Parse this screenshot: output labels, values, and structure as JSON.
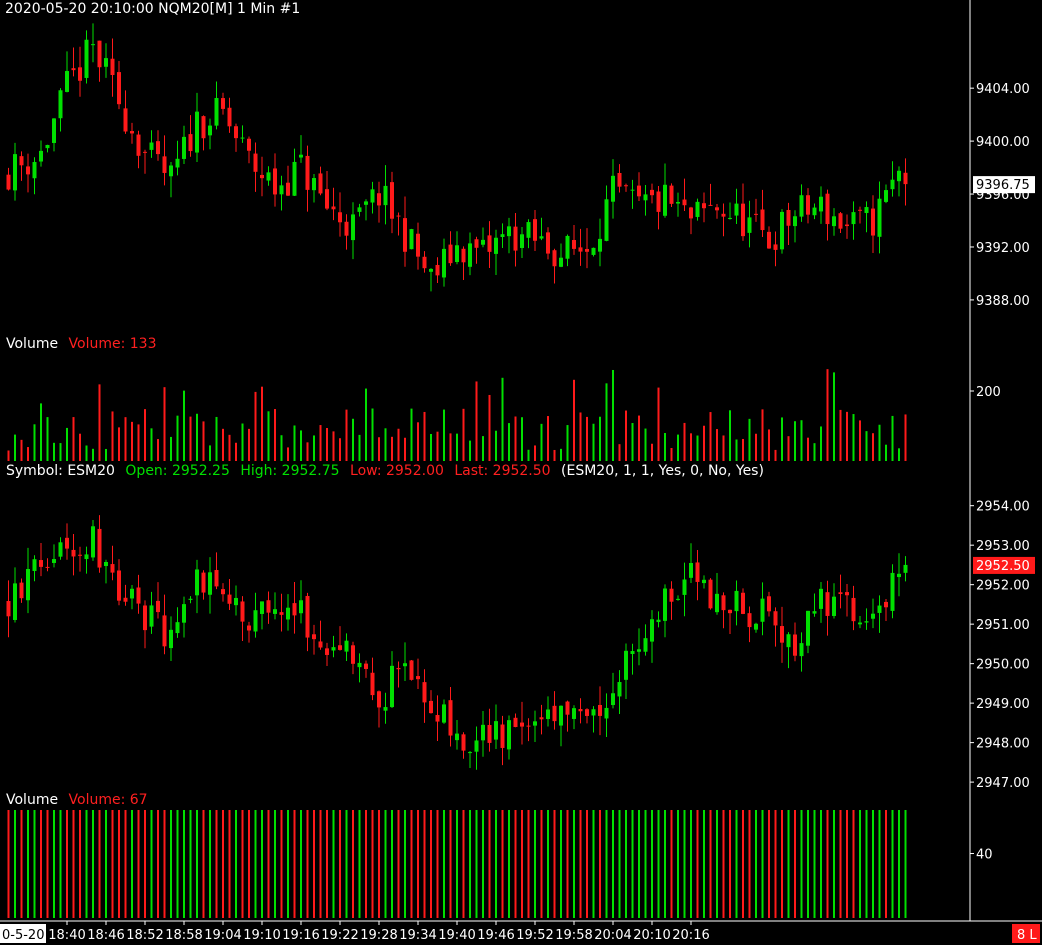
{
  "colors": {
    "background": "#000000",
    "up": "#00e000",
    "down": "#ff1a1a",
    "axis": "#ffffff",
    "text": "#ffffff"
  },
  "top_header": "2020-05-20 20:10:00 NQM20[M]  1 Min   #1",
  "panel2_header": {
    "label": "Volume",
    "value_text": "Volume: 133"
  },
  "panel3_header": {
    "symbol": "Symbol: ESM20",
    "open": "Open: 2952.25",
    "high": "High: 2952.75",
    "low": "Low: 2952.00",
    "last": "Last: 2952.50",
    "params": "(ESM20, 1, 1, Yes, 0, No, Yes)"
  },
  "panel4_header": {
    "label": "Volume",
    "value_text": "Volume: 67"
  },
  "date_corner": "0-5-20",
  "corner_badge": "8 L",
  "chart_data": [
    {
      "type": "candlestick",
      "name": "NQM20",
      "yticks": [
        9388,
        9392,
        9396,
        9400,
        9404
      ],
      "tick_labels": [
        "9388.00",
        "9392.00",
        "9396.00",
        "9400.00",
        "9404.00"
      ],
      "ylim": [
        9385.5,
        9409.0
      ],
      "last_badge": "9396.75",
      "last_value": 9396.75,
      "seed": 11,
      "keypoints": [
        [
          0,
          9397.5
        ],
        [
          6,
          9399
        ],
        [
          10,
          9404
        ],
        [
          14,
          9407
        ],
        [
          18,
          9403
        ],
        [
          22,
          9399
        ],
        [
          26,
          9397
        ],
        [
          30,
          9401.5
        ],
        [
          34,
          9402
        ],
        [
          38,
          9398.5
        ],
        [
          42,
          9396.5
        ],
        [
          46,
          9398
        ],
        [
          50,
          9395
        ],
        [
          54,
          9393.5
        ],
        [
          58,
          9396
        ],
        [
          62,
          9393
        ],
        [
          66,
          9389.5
        ],
        [
          70,
          9392
        ],
        [
          74,
          9391.5
        ],
        [
          78,
          9393
        ],
        [
          82,
          9392.5
        ],
        [
          86,
          9391.5
        ],
        [
          90,
          9392
        ],
        [
          94,
          9396
        ],
        [
          98,
          9395
        ],
        [
          102,
          9395.5
        ],
        [
          106,
          9394
        ],
        [
          110,
          9395
        ],
        [
          114,
          9394
        ],
        [
          118,
          9392.5
        ],
        [
          122,
          9394.5
        ],
        [
          126,
          9395
        ],
        [
          130,
          9393.5
        ],
        [
          134,
          9394
        ],
        [
          138,
          9397.5
        ]
      ]
    },
    {
      "type": "bar",
      "name": "Volume NQM20",
      "yticks": [
        200
      ],
      "tick_labels": [
        "200"
      ],
      "ylim": [
        0,
        300
      ],
      "seed": 23
    },
    {
      "type": "candlestick",
      "name": "ESM20",
      "yticks": [
        2947,
        2948,
        2949,
        2950,
        2951,
        2952,
        2953,
        2954
      ],
      "tick_labels": [
        "2947.00",
        "2948.00",
        "2949.00",
        "2950.00",
        "2951.00",
        "2952.00",
        "2953.00",
        "2954.00"
      ],
      "ylim": [
        2946.8,
        2954.6
      ],
      "last_badge": "2952.50",
      "last_value": 2952.5,
      "open": 2952.25,
      "high": 2952.75,
      "low": 2952.0,
      "last": 2952.5,
      "seed": 37,
      "keypoints": [
        [
          0,
          2951.5
        ],
        [
          6,
          2952.5
        ],
        [
          10,
          2953.0
        ],
        [
          14,
          2953.2
        ],
        [
          18,
          2952.0
        ],
        [
          22,
          2951.2
        ],
        [
          26,
          2950.5
        ],
        [
          30,
          2952.0
        ],
        [
          34,
          2951.7
        ],
        [
          38,
          2951.0
        ],
        [
          42,
          2951.8
        ],
        [
          46,
          2951.2
        ],
        [
          50,
          2950.5
        ],
        [
          54,
          2950.2
        ],
        [
          58,
          2949.0
        ],
        [
          62,
          2950.0
        ],
        [
          66,
          2949.0
        ],
        [
          70,
          2948.0
        ],
        [
          74,
          2948.4
        ],
        [
          78,
          2948.2
        ],
        [
          82,
          2949.0
        ],
        [
          86,
          2948.6
        ],
        [
          90,
          2948.4
        ],
        [
          94,
          2949.5
        ],
        [
          98,
          2950.8
        ],
        [
          102,
          2951.5
        ],
        [
          106,
          2952.2
        ],
        [
          110,
          2951.6
        ],
        [
          114,
          2951.3
        ],
        [
          118,
          2951.5
        ],
        [
          122,
          2950.4
        ],
        [
          126,
          2951.6
        ],
        [
          130,
          2951.3
        ],
        [
          134,
          2951.0
        ],
        [
          138,
          2952.5
        ]
      ]
    },
    {
      "type": "bar",
      "name": "Volume ESM20",
      "yticks": [
        40
      ],
      "tick_labels": [
        "40"
      ],
      "ylim": [
        0,
        67
      ],
      "seed": 41
    }
  ],
  "x_axis": {
    "labels": [
      "18:40",
      "18:46",
      "18:52",
      "18:58",
      "19:04",
      "19:10",
      "19:16",
      "19:22",
      "19:28",
      "19:34",
      "19:40",
      "19:46",
      "19:52",
      "19:58",
      "20:04",
      "20:10",
      "20:16"
    ],
    "bar_index_of_first": 9,
    "bars_per_label": 6,
    "bar_count": 139
  }
}
